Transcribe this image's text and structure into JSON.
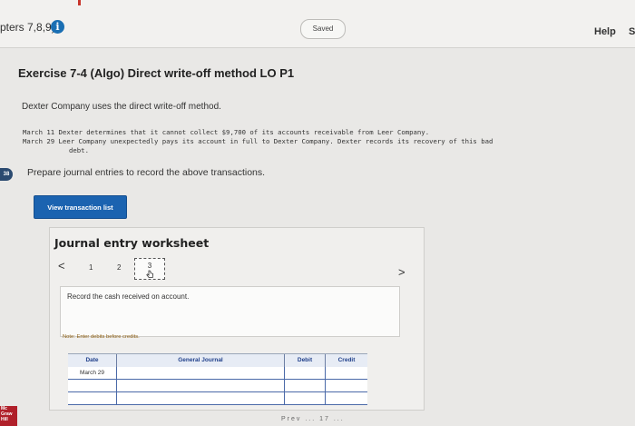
{
  "header": {
    "chapters": "pters 7,8,9)",
    "status": "Saved",
    "help": "Help",
    "help_cut": "S"
  },
  "exercise": {
    "title": "Exercise 7-4 (Algo) Direct write-off method LO P1",
    "intro": "Dexter Company uses the direct write-off method.",
    "transactions": [
      "March 11 Dexter determines that it cannot collect $9,700 of its accounts receivable from Leer Company.",
      "March 29 Leer Company unexpectedly pays its account in full to Dexter Company. Dexter records its recovery of this bad",
      "debt."
    ],
    "prepare": "Prepare journal entries to record the above transactions.",
    "side_badge": "38"
  },
  "view_button": "View transaction list",
  "worksheet": {
    "title": "Journal entry worksheet",
    "prev": "<",
    "next": ">",
    "pages": [
      "1",
      "2",
      "3"
    ],
    "instruction": "Record the cash received on account.",
    "note": "Note: Enter debits before credits.",
    "columns": [
      "Date",
      "General Journal",
      "Debit",
      "Credit"
    ],
    "rows": [
      {
        "date": "March 29",
        "account": "",
        "debit": "",
        "credit": ""
      },
      {
        "date": "",
        "account": "",
        "debit": "",
        "credit": ""
      },
      {
        "date": "",
        "account": "",
        "debit": "",
        "credit": ""
      }
    ]
  },
  "footer_fragment": "Prev ... 17 ...",
  "brand": "Mc Graw Hill"
}
